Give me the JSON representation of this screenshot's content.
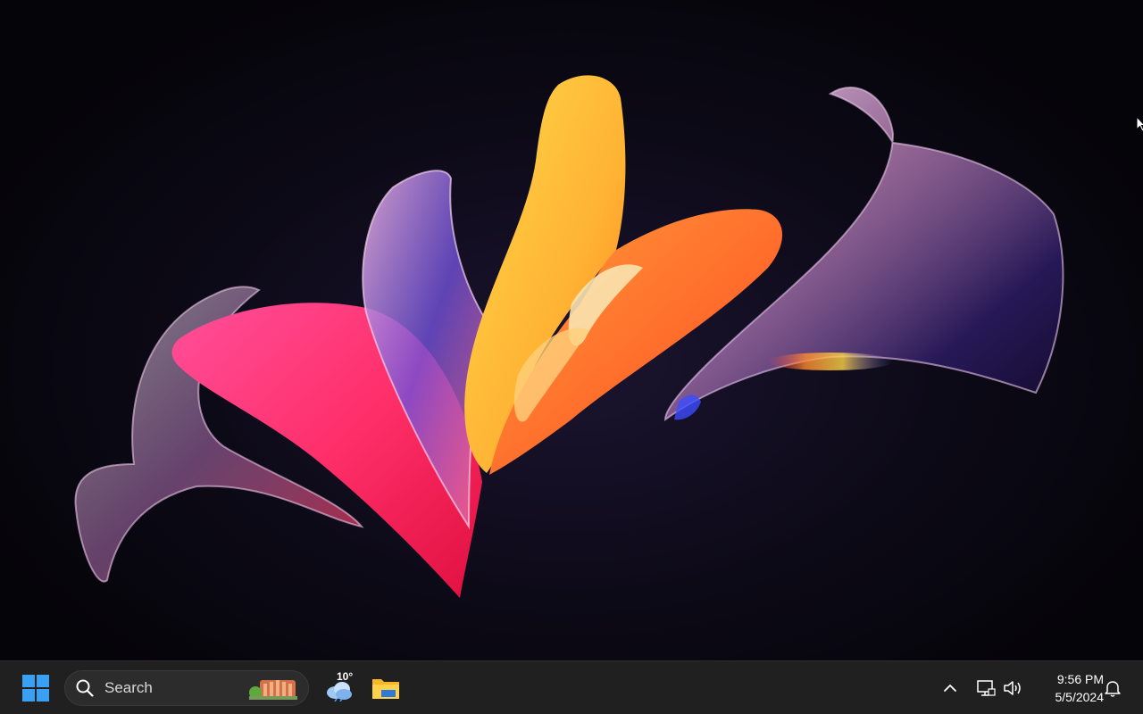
{
  "desktop": {
    "wallpaper": "windows-11-bloom-abstract",
    "colors": {
      "background": "#050409",
      "pink": "#ff2f7a",
      "orange": "#ff7a2a",
      "yellow": "#ffc53a",
      "violet": "#6a3cc8",
      "lavender": "#e6cce8"
    }
  },
  "taskbar": {
    "background": "#202020",
    "start": {
      "icon": "windows-logo-icon",
      "accent": "#3aa0f3"
    },
    "search": {
      "placeholder": "Search",
      "icon": "search-icon",
      "highlight_icon": "search-highlight-illustration-icon"
    },
    "weather": {
      "temperature": "10°",
      "icon": "cloudy-weather-icon"
    },
    "pinned": [
      {
        "name": "File Explorer",
        "icon": "folder-icon"
      }
    ],
    "tray": {
      "overflow_icon": "chevron-up-icon",
      "network_icon": "network-icon",
      "volume_icon": "volume-icon",
      "time": "9:56 PM",
      "date": "5/5/2024",
      "notification_icon": "bell-icon"
    }
  }
}
